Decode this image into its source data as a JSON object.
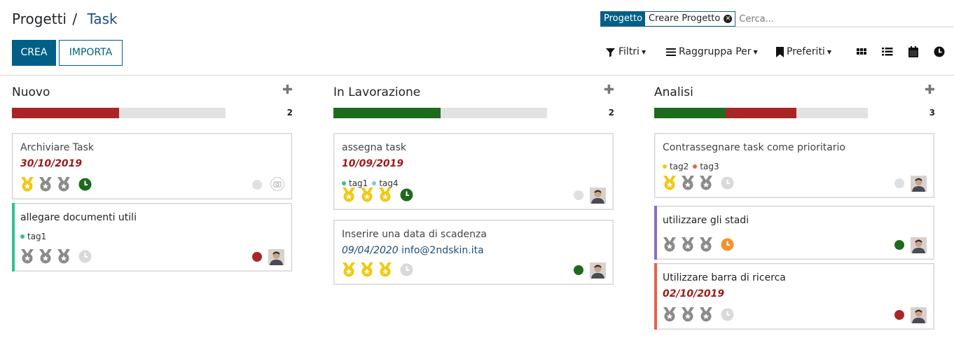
{
  "breadcrumb": {
    "parent": "Progetti",
    "separator": "/",
    "current": "Task"
  },
  "search": {
    "facet_label": "Progetto",
    "facet_value": "Creare Progetto",
    "placeholder": "Cerca..."
  },
  "buttons": {
    "create": "CREA",
    "import": "IMPORTA"
  },
  "toolbar": {
    "filters": "Filtri",
    "group_by": "Raggruppa Per",
    "favorites": "Preferiti"
  },
  "views": [
    "kanban-icon",
    "list-icon",
    "calendar-icon",
    "activity-icon"
  ],
  "colors": {
    "primary": "#005f87",
    "red": "#a82626",
    "green": "#1e6b1e",
    "orange": "#f0932e",
    "purple": "#8c6bc8",
    "teal": "#2ec28e"
  },
  "columns": [
    {
      "title": "Nuovo",
      "count": "2",
      "progress": [
        {
          "color": "#a82626",
          "fraction": 0.5
        }
      ],
      "cards": [
        {
          "title": "Archiviare Task",
          "date": "30/10/2019",
          "priority": 1,
          "activity": "green",
          "status": "grey",
          "tags": [],
          "avatar": "placeholder"
        },
        {
          "title": "allegare documenti utili",
          "date": "",
          "priority": 0,
          "activity": "grey",
          "status": "red",
          "tags": [
            {
              "name": "tag1",
              "color": "#2ec28e"
            }
          ],
          "avatar": "person",
          "left_color": "#2ec28e"
        }
      ]
    },
    {
      "title": "In Lavorazione",
      "count": "2",
      "progress": [
        {
          "color": "#1e6b1e",
          "fraction": 0.5
        }
      ],
      "cards": [
        {
          "title": "assegna task",
          "date": "10/09/2019",
          "priority": 3,
          "activity": "green",
          "status": "grey",
          "tags": [
            {
              "name": "tag1",
              "color": "#2ec28e"
            },
            {
              "name": "tag4",
              "color": "#7fc4ea"
            }
          ],
          "avatar": "person"
        },
        {
          "title": "Inserire una data di scadenza",
          "date_plain": "09/04/2020",
          "email": "info@2ndskin.ita",
          "priority": 3,
          "activity": "grey",
          "status": "green",
          "tags": [],
          "avatar": "person"
        }
      ]
    },
    {
      "title": "Analisi",
      "count": "3",
      "progress": [
        {
          "color": "#1e6b1e",
          "fraction": 0.333
        },
        {
          "color": "#a82626",
          "fraction": 0.333
        }
      ],
      "cards": [
        {
          "title": "Contrassegnare task come prioritario",
          "date": "",
          "priority": 1,
          "activity": "grey",
          "status": "grey",
          "tags": [
            {
              "name": "tag2",
              "color": "#f2c811"
            },
            {
              "name": "tag3",
              "color": "#e8604c"
            }
          ],
          "avatar": "person"
        },
        {
          "title": "utilizzare gli stadi",
          "date": "",
          "priority": 0,
          "activity": "orange",
          "status": "green",
          "tags": [],
          "avatar": "person",
          "left_color": "#8c6bc8"
        },
        {
          "title": "Utilizzare barra di ricerca",
          "date": "02/10/2019",
          "priority": 0,
          "activity": "grey",
          "status": "red",
          "tags": [],
          "avatar": "person",
          "left_color": "#e8604c"
        }
      ]
    }
  ]
}
